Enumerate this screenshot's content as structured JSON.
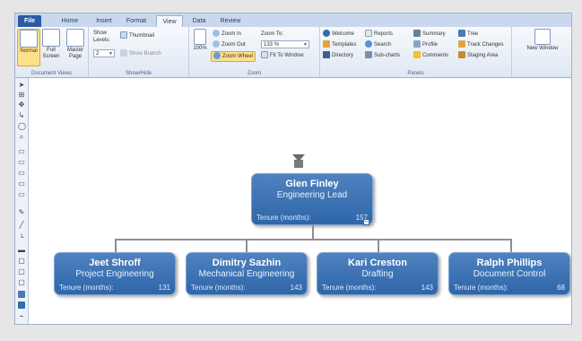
{
  "tabs": [
    {
      "label": "File"
    },
    {
      "label": "Home"
    },
    {
      "label": "Insert"
    },
    {
      "label": "Format"
    },
    {
      "label": "View"
    },
    {
      "label": "Data"
    },
    {
      "label": "Review"
    }
  ],
  "active_tab": "View",
  "ribbon": {
    "document_views": {
      "group_label": "Document Views",
      "normal_label": "Normal",
      "full_screen_label": "Full Screen",
      "master_page_label": "Master Page"
    },
    "show_hide": {
      "group_label": "Show/Hide",
      "show_levels_label": "Show Levels:",
      "levels_value": "2",
      "thumbnail_label": "Thumbnail",
      "show_branch_label": "Show Branch"
    },
    "zoom": {
      "group_label": "Zoom",
      "hundred_label": "100%",
      "zoom_in_label": "Zoom In",
      "zoom_out_label": "Zoom Out",
      "zoom_wheel_label": "Zoom Wheel",
      "zoom_to_label": "Zoom To:",
      "zoom_value": "133 %",
      "fit_to_window_label": "Fit To Window"
    },
    "panels": {
      "group_label": "Panels",
      "welcome_label": "Welcome",
      "templates_label": "Templates",
      "directory_label": "Directory",
      "reports_label": "Reports",
      "search_label": "Search",
      "subcharts_label": "Sub-charts",
      "summary_label": "Summary",
      "profile_label": "Profile",
      "comments_label": "Comments",
      "tree_label": "Tree",
      "track_changes_label": "Track Changes",
      "staging_area_label": "Staging Area"
    },
    "window": {
      "new_window_label": "New Window"
    }
  },
  "chart": {
    "root": {
      "name": "Glen Finley",
      "title": "Engineering Lead",
      "tenure_label": "Tenure (months):",
      "tenure_value": "157"
    },
    "children": [
      {
        "name": "Jeet Shroff",
        "title": "Project Engineering",
        "tenure_label": "Tenure (months):",
        "tenure_value": "131"
      },
      {
        "name": "Dimitry Sazhin",
        "title": "Mechanical Engineering",
        "tenure_label": "Tenure (months):",
        "tenure_value": "143"
      },
      {
        "name": "Kari Creston",
        "title": "Drafting",
        "tenure_label": "Tenure (months):",
        "tenure_value": "143"
      },
      {
        "name": "Ralph Phillips",
        "title": "Document Control",
        "tenure_label": "Tenure (months):",
        "tenure_value": "68"
      }
    ]
  },
  "colors": {
    "card": "#3a72b4",
    "file_tab": "#2a5aa8",
    "selected": "#ffe08a"
  }
}
